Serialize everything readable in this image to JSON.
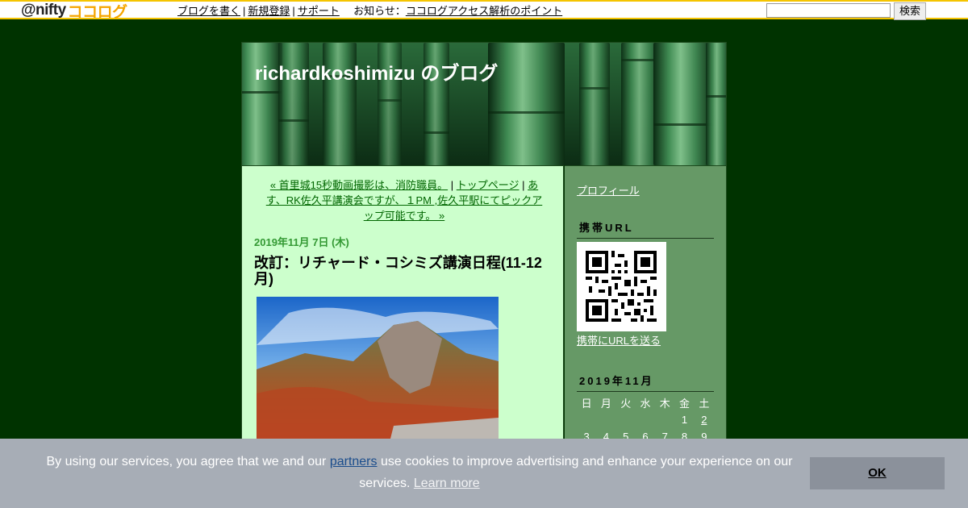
{
  "topbar": {
    "logo_prefix": "@nifty",
    "logo_suffix": "ココログ",
    "links": [
      "ブログを書く",
      "新規登録",
      "サポート",
      "お知らせ"
    ],
    "announce_sep": "：",
    "announce_link": "ココログアクセス解析のポイント",
    "search_button": "検索"
  },
  "blog": {
    "title": "richardkoshimizu のブログ",
    "nav": {
      "prev": "« 首里城15秒動画撮影は、消防職員。",
      "top": "トップページ",
      "next": "あす、RK佐久平講演会ですが、１PM ,佐久平駅にてピックアップ可能です。 »"
    },
    "post": {
      "date": "2019年11月 7日 (木)",
      "title": "改訂：リチャード・コシミズ講演日程(11-12月)"
    }
  },
  "sidebar": {
    "profile": "プロフィール",
    "mobile_heading": "携帯URL",
    "send_url": "携帯にURLを送る",
    "calendar": {
      "heading": "2019年11月",
      "weekdays": [
        "日",
        "月",
        "火",
        "水",
        "木",
        "金",
        "土"
      ],
      "row1": [
        "",
        "",
        "",
        "",
        "",
        "1",
        "2"
      ],
      "row2": [
        "3",
        "4",
        "5",
        "6",
        "7",
        "8",
        "9"
      ]
    }
  },
  "cookie": {
    "text_before": "By using our services, you agree that we and our ",
    "partners": "partners",
    "text_after": " use cookies to improve advertising and enhance your experience on our services. ",
    "learn_more": "Learn more",
    "ok": "OK"
  },
  "colors": {
    "page_bg": "#003300",
    "main_bg": "#ccffcc",
    "sidebar_bg": "#669966",
    "link_green": "#006600"
  }
}
